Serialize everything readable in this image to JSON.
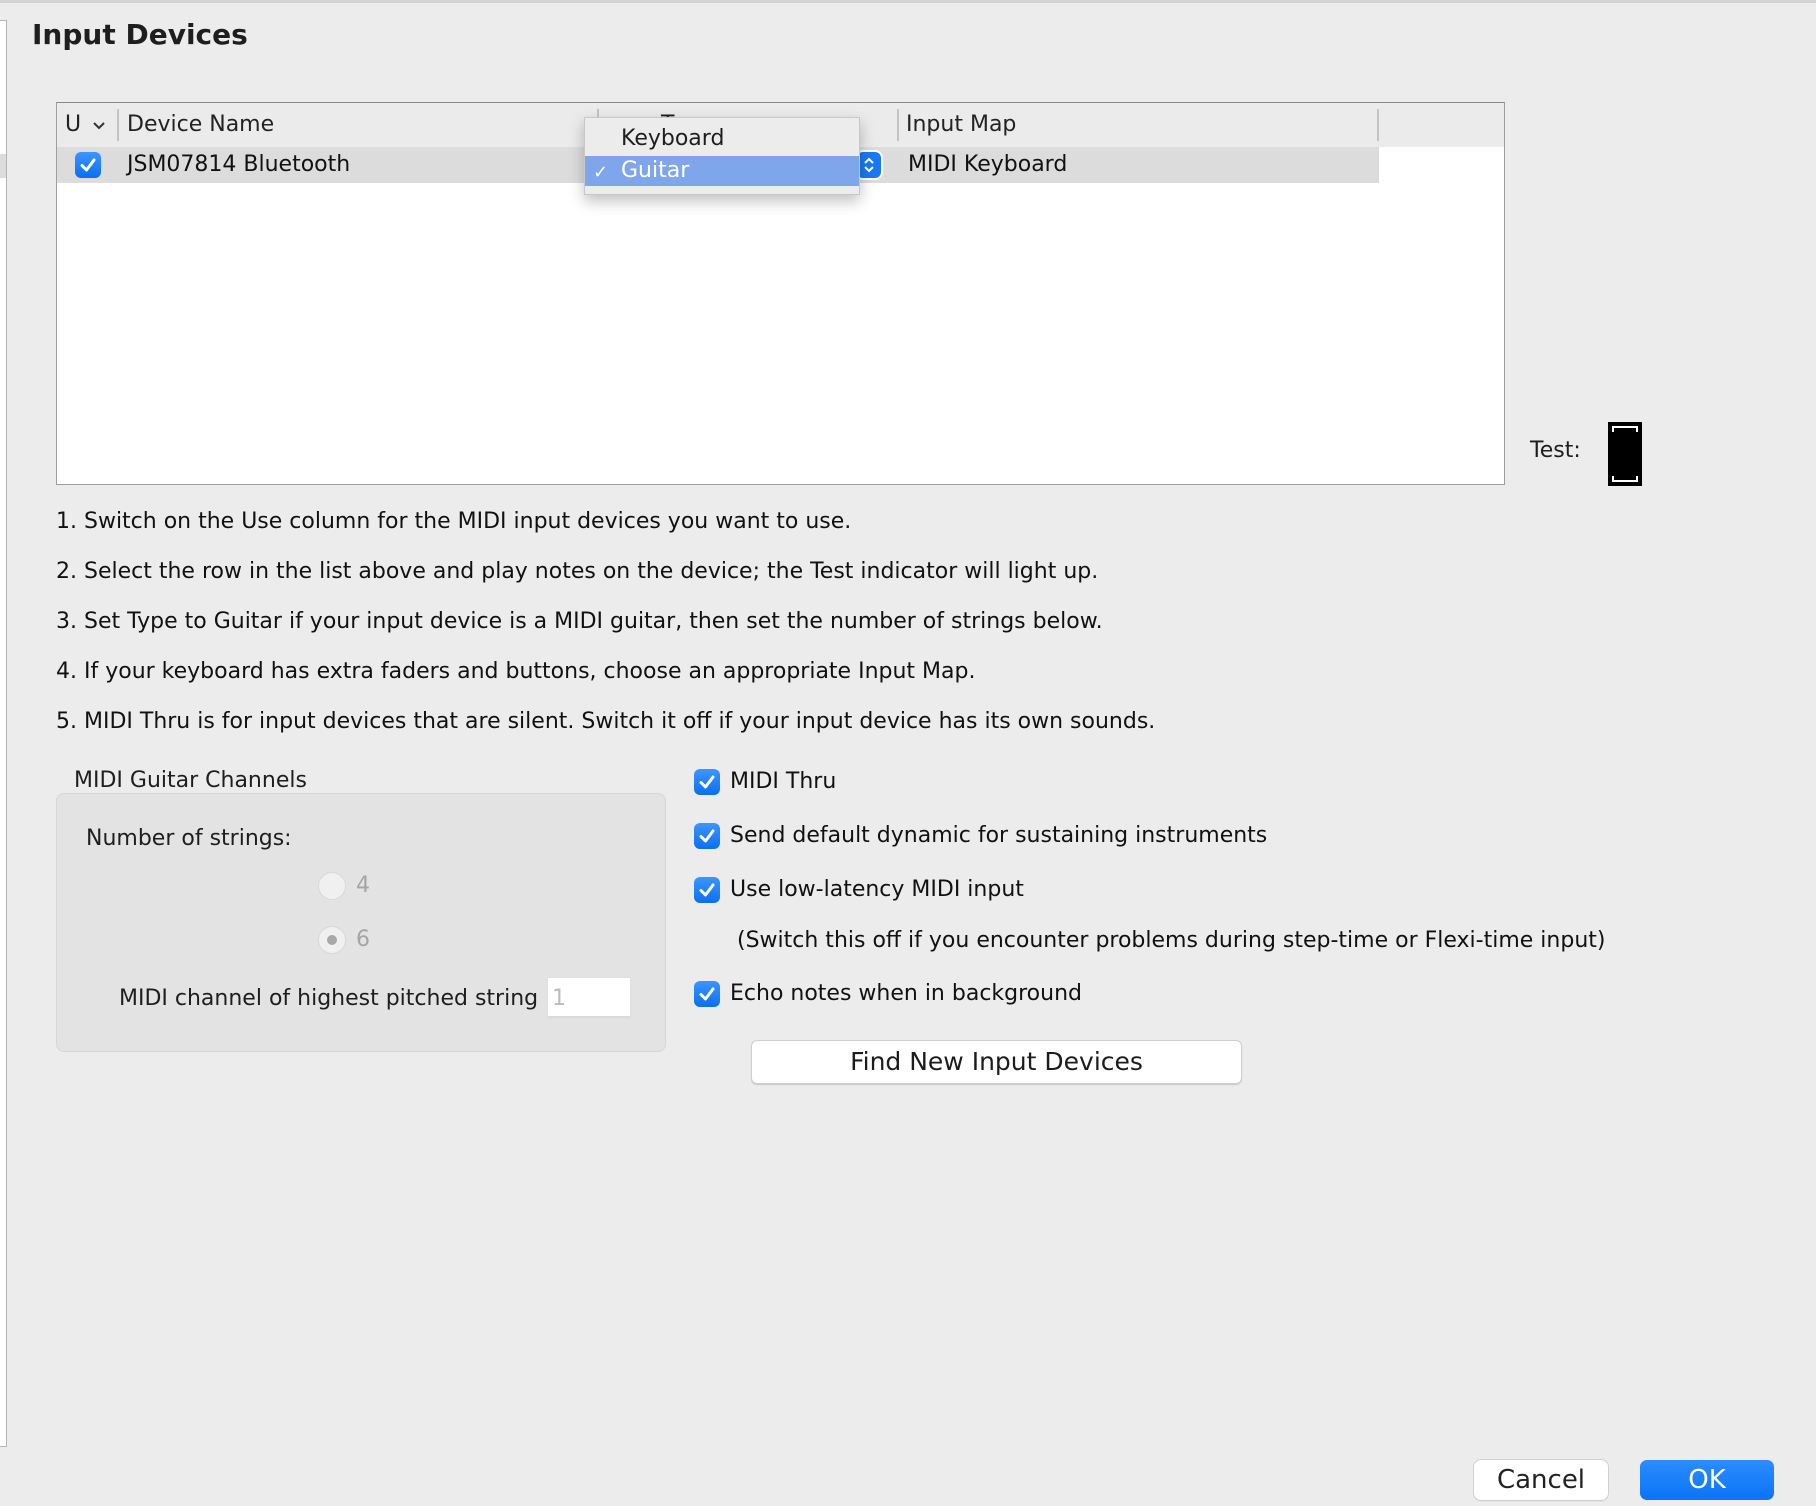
{
  "page": {
    "title": "Input Devices"
  },
  "table": {
    "columns": [
      {
        "label": "U",
        "sort_icon": "chevron-down-icon"
      },
      {
        "label": "Device Name"
      },
      {
        "label": "T"
      },
      {
        "label": "Input Map"
      }
    ],
    "rows": [
      {
        "use": true,
        "device_name": "JSM07814 Bluetooth",
        "type": "Guitar",
        "input_map": "MIDI Keyboard"
      }
    ]
  },
  "type_popup": {
    "options": [
      {
        "label": "Keyboard",
        "selected": false
      },
      {
        "label": "Guitar",
        "selected": true
      }
    ],
    "check_glyph": "✓"
  },
  "test": {
    "label": "Test:"
  },
  "instructions": [
    "1. Switch on the Use column for the MIDI input devices you want to use.",
    "2. Select the row in the list above and play notes on the device; the Test indicator will light up.",
    "3. Set Type to Guitar if your input device is a MIDI guitar, then set the number of strings below.",
    "4. If your keyboard has extra faders and buttons, choose an appropriate Input Map.",
    "5. MIDI Thru is for input devices that are silent. Switch it off if your input device has its own sounds."
  ],
  "guitar_channels": {
    "group_label": "MIDI Guitar Channels",
    "strings_label": "Number of strings:",
    "string_options": [
      {
        "label": "4",
        "selected": false
      },
      {
        "label": "6",
        "selected": true
      }
    ],
    "channel_label": "MIDI channel of highest pitched string",
    "channel_value": "1",
    "enabled": false
  },
  "options": [
    {
      "label": "MIDI Thru",
      "checked": true
    },
    {
      "label": "Send default dynamic for sustaining instruments",
      "checked": true
    },
    {
      "label": "Use low-latency MIDI input",
      "checked": true
    },
    {
      "label": "Echo notes when in background",
      "checked": true
    }
  ],
  "low_latency_note": "(Switch this off if you encounter problems during step-time or Flexi-time input)",
  "buttons": {
    "find": "Find New Input Devices",
    "cancel": "Cancel",
    "ok": "OK"
  },
  "colors": {
    "accent": "#0a74f5",
    "selection": "#7fa6ea"
  }
}
